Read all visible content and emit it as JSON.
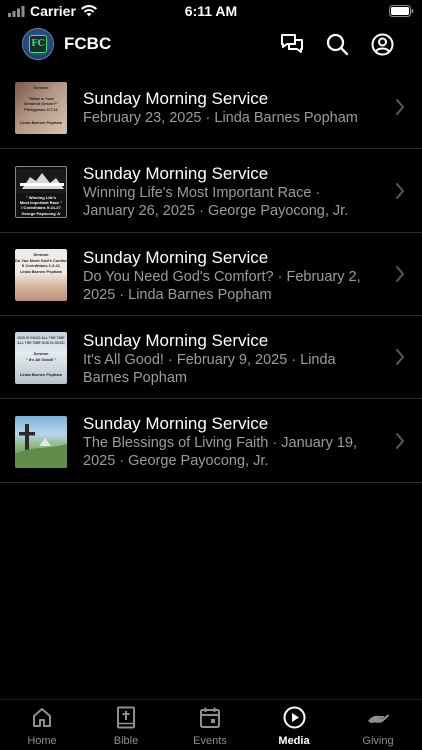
{
  "status_bar": {
    "carrier": "Carrier",
    "time": "6:11 AM"
  },
  "header": {
    "logo_text": "FC",
    "title": "FCBC"
  },
  "media_items": [
    {
      "title": "Sunday Morning Service",
      "subtitle": "February 23, 2025 · Linda Barnes Popham",
      "thumb_lines": [
        "Sermon",
        "\"What is Your",
        "Greatest Desire?\"",
        "Philippians 3:7-11",
        "Linda Barnes Popham"
      ]
    },
    {
      "title": "Sunday Morning Service",
      "subtitle": "Winning Life's Most Important Race · January 26, 2025 · George Payocong, Jr.",
      "thumb_lines": [
        "\" Winning Life's",
        "Most Important Race \"",
        "I Corinthians 9:24-27",
        "George Payocong Jr"
      ]
    },
    {
      "title": "Sunday Morning Service",
      "subtitle": "Do You Need God's Comfort? · February 2, 2025 · Linda Barnes Popham",
      "thumb_lines": [
        "Sermon",
        "Do You Need God's Comfort?",
        "II Corinthians 1:3-11",
        "Linda Barnes Popham"
      ]
    },
    {
      "title": "Sunday Morning Service",
      "subtitle": "It's All Good! · February 9, 2025 · Linda Barnes Popham",
      "thumb_lines": [
        "GOD IS GOOD ALL THE TIME",
        "ALL THE TIME GOD IS GOOD",
        "Sermon",
        "\" It's All Good! \"",
        "Linda Barnes Popham"
      ]
    },
    {
      "title": "Sunday Morning Service",
      "subtitle": "The Blessings of Living Faith · January 19, 2025 · George Payocong, Jr.",
      "thumb_lines": []
    }
  ],
  "tabs": [
    {
      "label": "Home",
      "icon": "home-icon",
      "active": false
    },
    {
      "label": "Bible",
      "icon": "bible-icon",
      "active": false
    },
    {
      "label": "Events",
      "icon": "calendar-icon",
      "active": false
    },
    {
      "label": "Media",
      "icon": "play-icon",
      "active": true
    },
    {
      "label": "Giving",
      "icon": "giving-hand-icon",
      "active": false
    }
  ],
  "colors": {
    "background": "#000000",
    "text_primary": "#ffffff",
    "text_secondary": "#9b9ba0",
    "separator": "#2c2c2e",
    "tab_inactive": "#8e8e93"
  }
}
